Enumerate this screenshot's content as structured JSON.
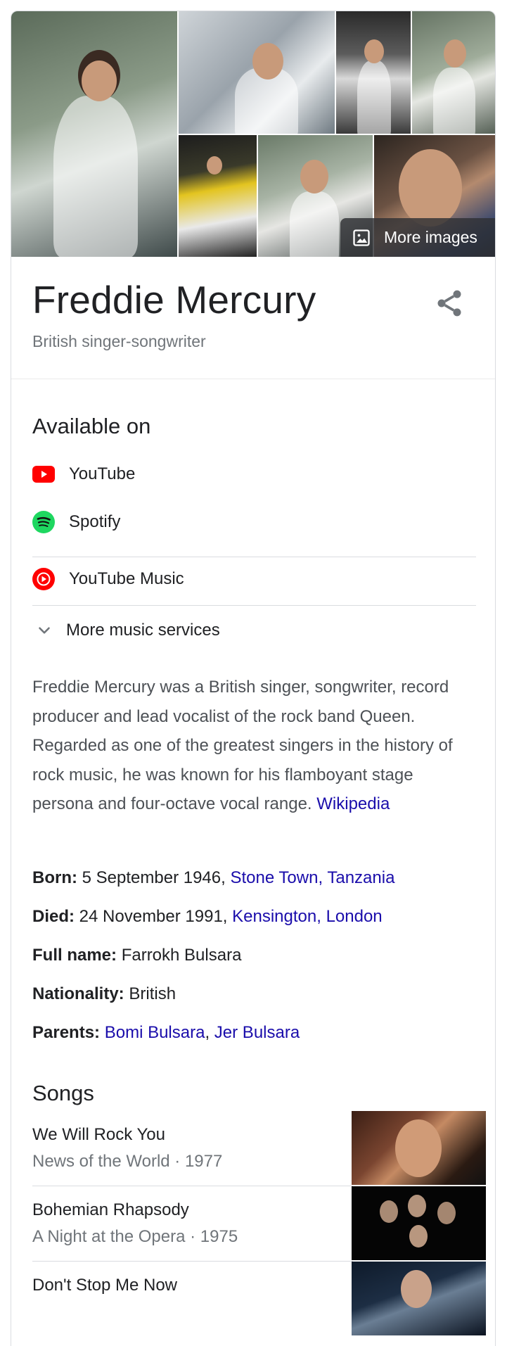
{
  "collage": {
    "more_images_label": "More images"
  },
  "header": {
    "title": "Freddie Mercury",
    "subtitle": "British singer-songwriter"
  },
  "available": {
    "heading": "Available on",
    "services": [
      {
        "name": "YouTube",
        "icon": "youtube-icon",
        "color": "#ff0000"
      },
      {
        "name": "Spotify",
        "icon": "spotify-icon",
        "color": "#1ed760"
      },
      {
        "name": "YouTube Music",
        "icon": "youtube-music-icon",
        "color": "#ff0000"
      }
    ],
    "more_label": "More music services"
  },
  "description": {
    "text": "Freddie Mercury was a British singer, songwriter, record producer and lead vocalist of the rock band Queen. Regarded as one of the greatest singers in the history of rock music, he was known for his flamboyant stage persona and four-octave vocal range.",
    "source": "Wikipedia"
  },
  "facts": {
    "born_label": "Born:",
    "born_date": "5 September 1946,",
    "born_place": "Stone Town, Tanzania",
    "died_label": "Died:",
    "died_date": "24 November 1991,",
    "died_place": "Kensington, London",
    "fullname_label": "Full name:",
    "fullname_value": "Farrokh Bulsara",
    "nationality_label": "Nationality:",
    "nationality_value": "British",
    "parents_label": "Parents:",
    "parent1": "Bomi Bulsara",
    "parent2": "Jer Bulsara"
  },
  "songs": {
    "heading": "Songs",
    "items": [
      {
        "title": "We Will Rock You",
        "subtitle": "News of the World · 1977"
      },
      {
        "title": "Bohemian Rhapsody",
        "subtitle": "A Night at the Opera · 1975"
      },
      {
        "title": "Don't Stop Me Now",
        "subtitle": ""
      }
    ]
  },
  "colors": {
    "link": "#1a0dab",
    "secondary_text": "#70757a",
    "divider": "#dadce0"
  }
}
